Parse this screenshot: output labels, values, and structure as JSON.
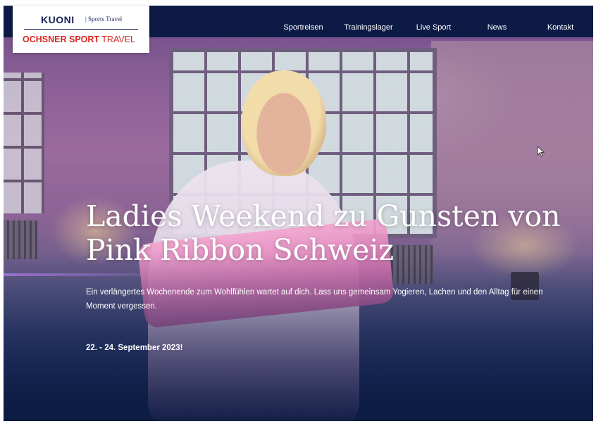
{
  "brand": {
    "kuoni": "KUONI",
    "kuoni_sub": "| Sports Travel",
    "ochsner_bold": "OCHSNER SPORT",
    "ochsner_light": " TRAVEL"
  },
  "nav": {
    "items": [
      {
        "label": "Sportreisen"
      },
      {
        "label": "Trainingslager"
      },
      {
        "label": "Live Sport"
      },
      {
        "label": "News"
      },
      {
        "label": "Kontakt"
      }
    ]
  },
  "hero": {
    "title": "Ladies Weekend zu Gunsten von Pink Ribbon Schweiz",
    "lead": "Ein verlängertes Wochenende zum Wohlfühlen wartet auf dich. Lass uns gemeinsam Yogieren, Lachen und den Alltag für einen Moment vergessen.",
    "date": "22. - 24. September 2023!"
  },
  "colors": {
    "header_bg": "#0c1a45",
    "brand_navy": "#17245c",
    "brand_red": "#d7261e",
    "text_on_hero": "#ffffff"
  },
  "icons": {
    "cursor": "mouse-pointer-icon"
  }
}
